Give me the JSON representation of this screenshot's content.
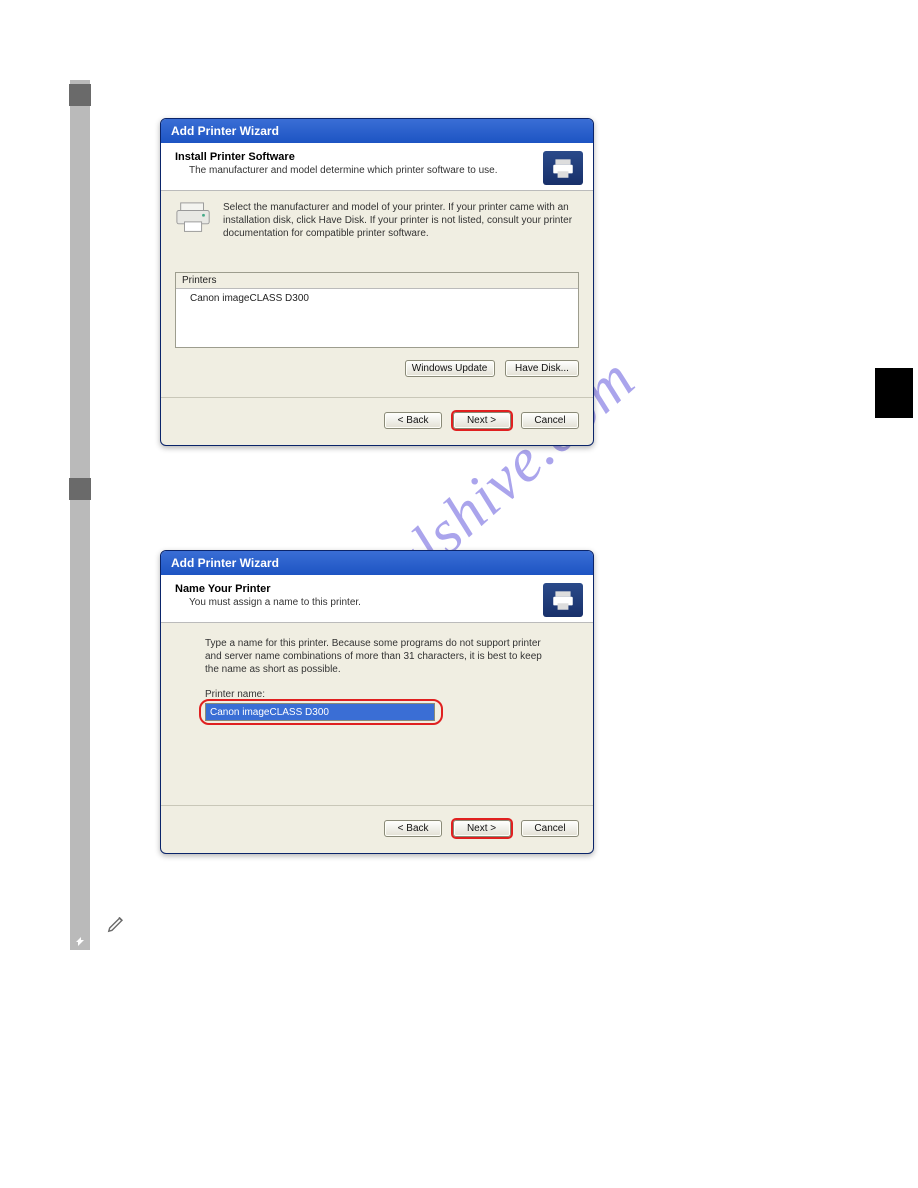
{
  "watermark": "manualshive.com",
  "dialog1": {
    "title": "Add Printer Wizard",
    "header_title": "Install Printer Software",
    "header_sub": "The manufacturer and model determine which printer software to use.",
    "instructions": "Select the manufacturer and model of your printer. If your printer came with an installation disk, click Have Disk. If your printer is not listed, consult your printer documentation for compatible printer software.",
    "list_header": "Printers",
    "list_items": [
      "Canon imageCLASS D300"
    ],
    "buttons": {
      "windows_update": "Windows Update",
      "have_disk": "Have Disk...",
      "back": "< Back",
      "next": "Next >",
      "cancel": "Cancel"
    }
  },
  "dialog2": {
    "title": "Add Printer Wizard",
    "header_title": "Name Your Printer",
    "header_sub": "You must assign a name to this printer.",
    "instructions": "Type a name for this printer. Because some programs do not support printer and server name combinations of more than 31 characters, it is best to keep the name as short as possible.",
    "field_label": "Printer name:",
    "field_value": "Canon imageCLASS D300",
    "buttons": {
      "back": "< Back",
      "next": "Next >",
      "cancel": "Cancel"
    }
  }
}
